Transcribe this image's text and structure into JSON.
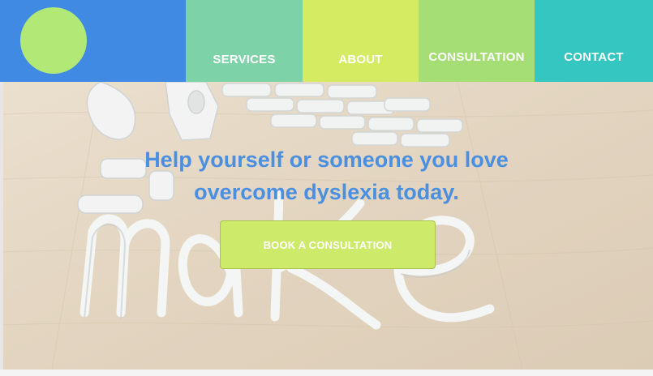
{
  "brand": {
    "logo": "green-circle-logo"
  },
  "nav": {
    "items": [
      {
        "label": "SERVICES"
      },
      {
        "label": "ABOUT"
      },
      {
        "label": "CONSULTATION"
      },
      {
        "label": "CONTACT"
      }
    ]
  },
  "hero": {
    "image": "clay letters spelling make on wooden table",
    "headline_line1": "Help yourself or someone you love",
    "headline_line2": "overcome dyslexia today.",
    "cta_label": "BOOK A CONSULTATION"
  },
  "colors": {
    "logo_block": "#418ae4",
    "logo_circle": "#b2e876",
    "services": "#7dd2a8",
    "about": "#d4eb62",
    "consultation": "#a5de74",
    "contact": "#35c6c2",
    "headline": "#4a8fe0",
    "cta": "#cdea6a"
  }
}
